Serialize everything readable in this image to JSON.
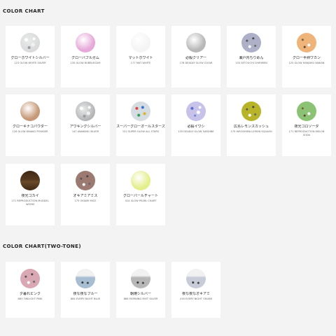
{
  "sections": [
    {
      "title": "COLOR CHART",
      "items": [
        {
          "name": "グローホワイトシルバー",
          "code": "123 GLOW WHITE SILVER",
          "color": "#d8dadb",
          "pattern": "speckle-silver"
        },
        {
          "name": "グローバブルガム",
          "code": "135 GLOW BUBBLEGUM",
          "color": "#e6a9d9",
          "pattern": "solid"
        },
        {
          "name": "マットホワイト",
          "code": "177 MAT WHITE",
          "color": "#f4f4f4",
          "pattern": "solid"
        },
        {
          "name": "必殺クリアー",
          "code": "178 DEADLY GLOW CLEAR",
          "color": "#b8b8b8",
          "pattern": "solid"
        },
        {
          "name": "瀬戸内ちりめん",
          "code": "133 SETOUCHI CHIRIMEN",
          "color": "#aeb0c8",
          "pattern": "speckle-dark"
        },
        {
          "name": "グロー半熟ワカン",
          "code": "125 GLOW HANJUKU WAKAN",
          "color": "#eeb47a",
          "pattern": "speckle-light"
        },
        {
          "name": "グローキナコパウダー",
          "code": "126 GLOW KINAKO POWDER",
          "color": "#c69a78",
          "pattern": "solid"
        },
        {
          "name": "アワキングシルバー",
          "code": "147 AWAKING SILVER",
          "color": "#b0b2b4",
          "pattern": "speckle-silver"
        },
        {
          "name": "スーパーグローオールスターズ",
          "code": "152 SUPER GLOW ALL STARS",
          "color": "#d5dde2",
          "pattern": "confetti"
        },
        {
          "name": "必殺イワシ",
          "code": "155 DEADLY GLOW SARDINE",
          "color": "#c6c2ea",
          "pattern": "speckle-blue"
        },
        {
          "name": "広島レモンスカッシュ",
          "code": "170 HIROSHIMA LEMON SQUASH",
          "color": "#b8b42a",
          "pattern": "speckle-dark"
        },
        {
          "name": "夜光ゴロソーダ",
          "code": "171 REPRODUCTION MELON SODA",
          "color": "#8cc274",
          "pattern": "speckle-light"
        },
        {
          "name": "夜光ゴカイ",
          "code": "171 REPRODUCTION MUDDEL WORM",
          "color": "#55391f",
          "pattern": "worm"
        },
        {
          "name": "オキアミアミス",
          "code": "175 OKIAMI MICE",
          "color": "#9c7a72",
          "pattern": "speckle-dark"
        },
        {
          "name": "グローパールチャート",
          "code": "414 GLOW PEARL CHART",
          "color": "#e4ef8c",
          "pattern": "solid"
        }
      ]
    },
    {
      "title": "COLOR CHART(TWO-TONE)",
      "items": [
        {
          "name": "夕暮れピンク",
          "code": "883 TWILIGHT PINK",
          "color": "#d9a8b4",
          "pattern": "speckle-dark"
        },
        {
          "name": "夜な夜なブルー",
          "code": "884 EVERY NIGHT BLUE",
          "color": "#a7bed2",
          "pattern": "twotone"
        },
        {
          "name": "朝焼シルバー",
          "code": "886 MORNING MIST SILVER",
          "color": "#b7b7b7",
          "pattern": "twotone"
        },
        {
          "name": "夜な夜なオキアミ",
          "code": "416 EVERY NIGHT OKIAMI",
          "color": "#c8ccd8",
          "pattern": "twotone"
        }
      ]
    }
  ]
}
